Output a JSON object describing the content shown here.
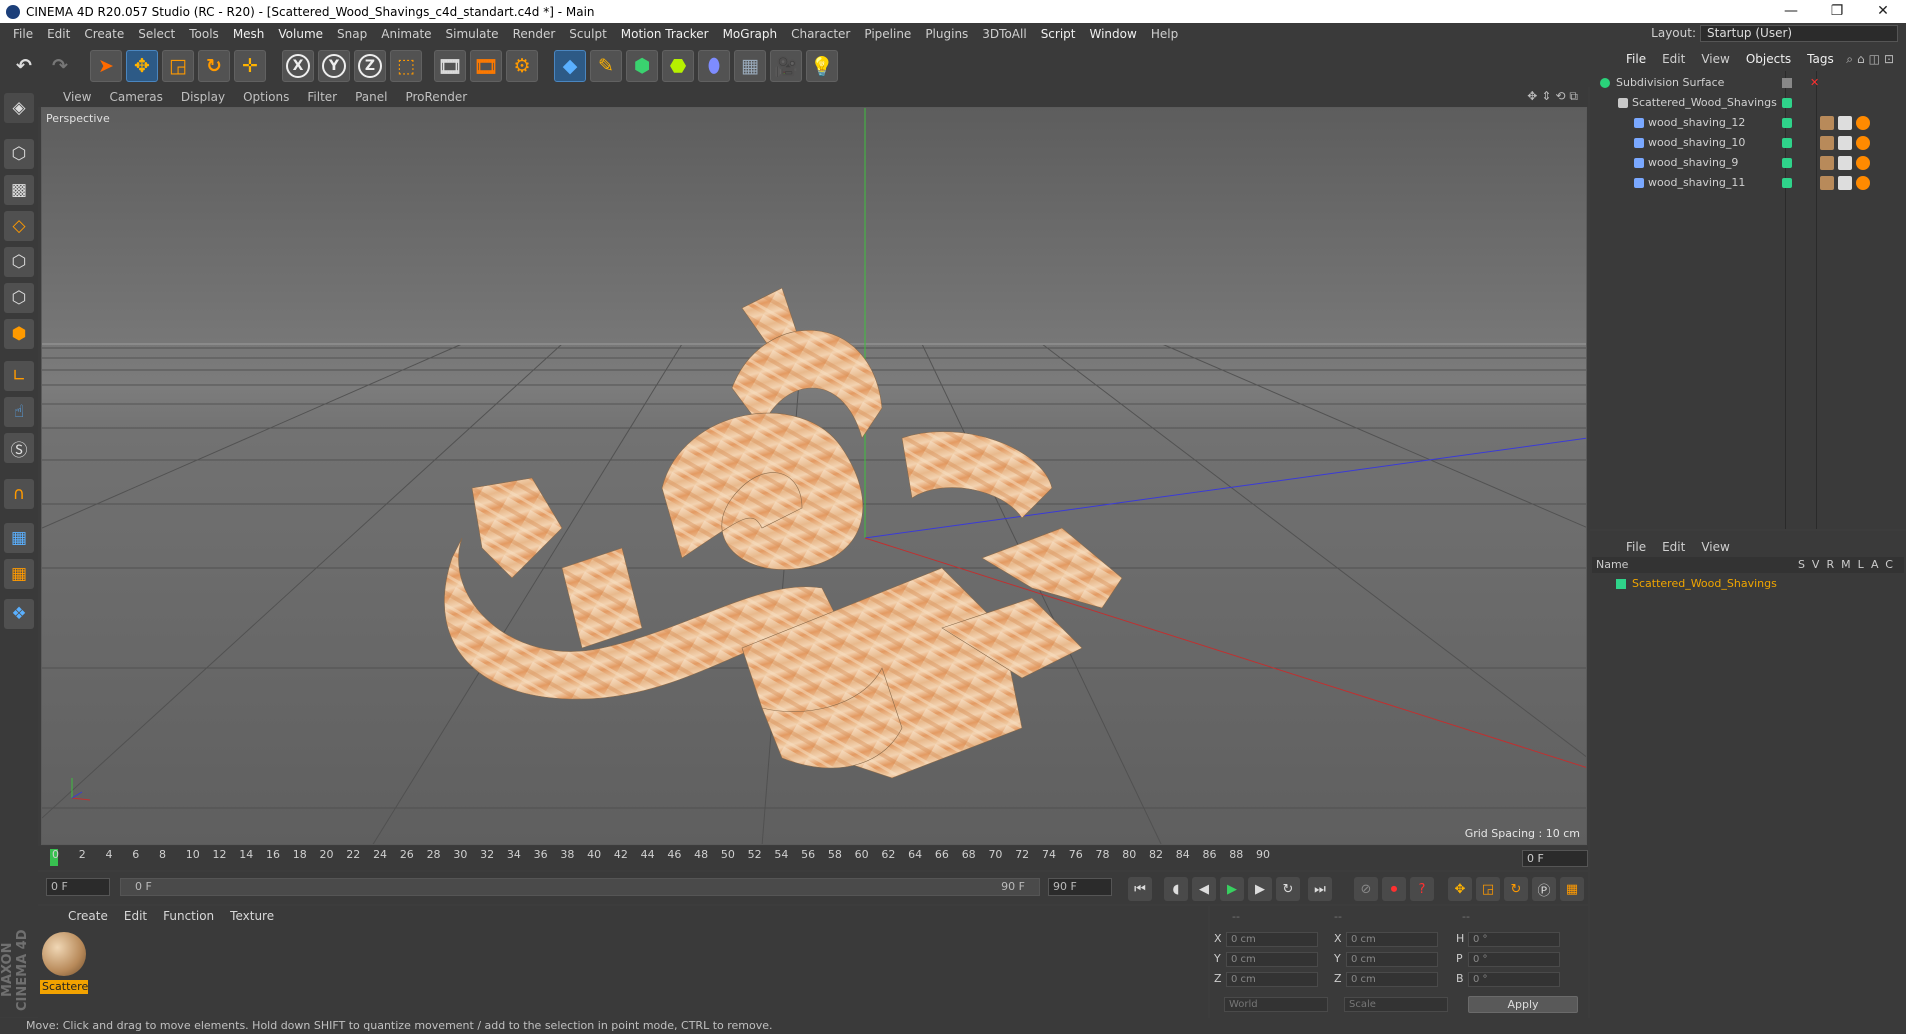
{
  "window": {
    "title": "CINEMA 4D R20.057 Studio (RC - R20) - [Scattered_Wood_Shavings_c4d_standart.c4d *] - Main",
    "controls": [
      "—",
      "❐",
      "✕"
    ]
  },
  "menubar": {
    "items": [
      "File",
      "Edit",
      "Create",
      "Select",
      "Tools",
      "Mesh",
      "Volume",
      "Snap",
      "Animate",
      "Simulate",
      "Render",
      "Sculpt",
      "Motion Tracker",
      "MoGraph",
      "Character",
      "Pipeline",
      "Plugins",
      "3DToAll",
      "Script",
      "Window",
      "Help"
    ],
    "layout_label": "Layout:",
    "layout_value": "Startup (User)"
  },
  "toolbar": {
    "icons": [
      "undo-icon",
      "redo-icon",
      "select-cursor-icon",
      "move-icon",
      "scale-icon",
      "rotate-icon",
      "move-add-icon",
      "x-axis-icon",
      "y-axis-icon",
      "z-axis-icon",
      "coordinate-system-icon",
      "render-view-icon",
      "render-picture-viewer-icon",
      "render-settings-icon",
      "cube-icon",
      "pen-icon",
      "subdivision-icon",
      "extrude-icon",
      "deformer-icon",
      "floor-icon",
      "camera-icon",
      "light-icon"
    ],
    "axis_labels": [
      "X",
      "Y",
      "Z"
    ]
  },
  "viewport": {
    "menu": [
      "View",
      "Cameras",
      "Display",
      "Options",
      "Filter",
      "Panel",
      "ProRender"
    ],
    "label": "Perspective",
    "grid_spacing": "Grid Spacing : 10 cm"
  },
  "timeline": {
    "ticks": [
      "0",
      "2",
      "4",
      "6",
      "8",
      "10",
      "12",
      "14",
      "16",
      "18",
      "20",
      "22",
      "24",
      "26",
      "28",
      "30",
      "32",
      "34",
      "36",
      "38",
      "40",
      "42",
      "44",
      "46",
      "48",
      "50",
      "52",
      "54",
      "56",
      "58",
      "60",
      "62",
      "64",
      "66",
      "68",
      "70",
      "72",
      "74",
      "76",
      "78",
      "80",
      "82",
      "84",
      "86",
      "88",
      "90"
    ],
    "current_frame": "0 F"
  },
  "playback": {
    "start_field": "0 F",
    "range_start": "0 F",
    "range_end": "90 F",
    "end_field": "90 F"
  },
  "material_panel": {
    "menu": [
      "Create",
      "Edit",
      "Function",
      "Texture"
    ],
    "material_name": "Scattere",
    "brand": "MAXON CINEMA 4D"
  },
  "coordinates": {
    "col1_labels": [
      "X",
      "Y",
      "Z"
    ],
    "col1_values": [
      "0 cm",
      "0 cm",
      "0 cm"
    ],
    "col2_labels": [
      "X",
      "Y",
      "Z"
    ],
    "col2_values": [
      "0 cm",
      "0 cm",
      "0 cm"
    ],
    "col3_labels": [
      "H",
      "P",
      "B"
    ],
    "col3_values": [
      "0 °",
      "0 °",
      "0 °"
    ],
    "header_dashes": [
      "--",
      "--",
      "--"
    ],
    "world_select": "World",
    "scale_select": "Scale",
    "apply_label": "Apply"
  },
  "status_bar": {
    "text": "Move: Click and drag to move elements. Hold down SHIFT to quantize movement / add to the selection in point mode, CTRL to remove."
  },
  "object_manager": {
    "menu": [
      "File",
      "Edit",
      "View",
      "Objects",
      "Tags"
    ],
    "objects": [
      {
        "name": "Subdivision Surface"
      },
      {
        "name": "Scattered_Wood_Shavings"
      },
      {
        "name": "wood_shaving_12"
      },
      {
        "name": "wood_shaving_10"
      },
      {
        "name": "wood_shaving_9"
      },
      {
        "name": "wood_shaving_11"
      }
    ]
  },
  "attribute_manager": {
    "menu": [
      "File",
      "Edit",
      "View"
    ],
    "header_name": "Name",
    "header_cols": "SVRMLAC",
    "row_name": "Scattered_Wood_Shavings"
  }
}
